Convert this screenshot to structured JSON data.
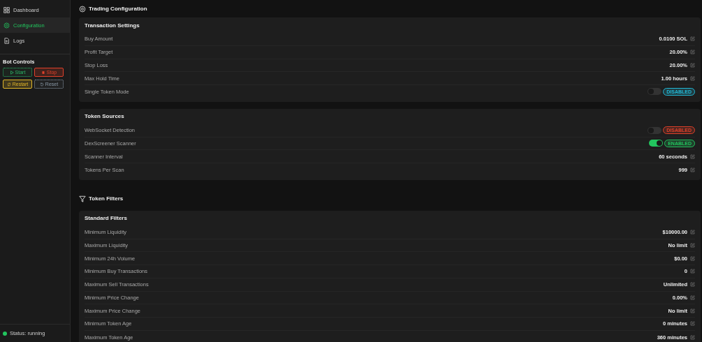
{
  "sidebar": {
    "nav": [
      {
        "label": "Dashboard",
        "selected": false
      },
      {
        "label": "Configuration",
        "selected": true
      },
      {
        "label": "Logs",
        "selected": false
      }
    ],
    "bot_controls": {
      "title": "Bot Controls",
      "buttons": [
        {
          "label": "Start",
          "color": "#2bb566",
          "disabled": true
        },
        {
          "label": "Stop",
          "color": "#e0402a",
          "disabled": false
        },
        {
          "label": "Restart",
          "color": "#e0b52a",
          "disabled": false
        },
        {
          "label": "Reset",
          "color": "#8a99a8",
          "disabled": true
        }
      ]
    },
    "status": {
      "text": "Status: running",
      "color": "#22c55e"
    }
  },
  "sections": [
    {
      "title": "Trading Configuration",
      "cards": [
        {
          "title": "Transaction Settings",
          "rows": [
            {
              "kind": "value",
              "label": "Buy Amount",
              "value": "0.0100 SOL"
            },
            {
              "kind": "value",
              "label": "Profit Target",
              "value": "20.00%"
            },
            {
              "kind": "value",
              "label": "Stop Loss",
              "value": "20.00%"
            },
            {
              "kind": "value",
              "label": "Max Hold Time",
              "value": "1.00 hours"
            },
            {
              "kind": "toggle",
              "label": "Single Token Mode",
              "on": false,
              "badge": "DISABLED",
              "color": "#22b8d6"
            }
          ]
        },
        {
          "title": "Token Sources",
          "rows": [
            {
              "kind": "toggle",
              "label": "WebSocket Detection",
              "on": false,
              "badge": "DISABLED",
              "color": "#e0402a"
            },
            {
              "kind": "toggle",
              "label": "DexScreener Scanner",
              "on": true,
              "badge": "ENABLED",
              "color": "#22c55e"
            },
            {
              "kind": "value",
              "label": "Scanner Interval",
              "value": "60 seconds"
            },
            {
              "kind": "value",
              "label": "Tokens Per Scan",
              "value": "999"
            }
          ]
        }
      ]
    },
    {
      "title": "Token Filters",
      "cards": [
        {
          "title": "Standard Filters",
          "rows": [
            {
              "kind": "value",
              "label": "Minimum Liquidity",
              "value": "$10000.00"
            },
            {
              "kind": "value",
              "label": "Maximum Liquidity",
              "value": "No limit"
            },
            {
              "kind": "value",
              "label": "Minimum 24h Volume",
              "value": "$0.00"
            },
            {
              "kind": "value",
              "label": "Minimum Buy Transactions",
              "value": "0"
            },
            {
              "kind": "value",
              "label": "Maximum Sell Transactions",
              "value": "Unlimited"
            },
            {
              "kind": "value",
              "label": "Minimum Price Change",
              "value": "0.00%"
            },
            {
              "kind": "value",
              "label": "Maximum Price Change",
              "value": "No limit"
            },
            {
              "kind": "value",
              "label": "Minimum Token Age",
              "value": "0 minutes"
            },
            {
              "kind": "value",
              "label": "Maximum Token Age",
              "value": "360 minutes"
            }
          ]
        }
      ]
    }
  ]
}
